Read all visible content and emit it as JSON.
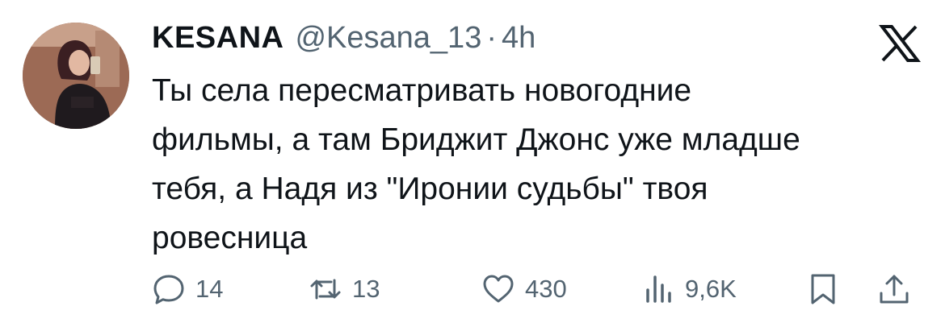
{
  "author": {
    "name": "KESANA",
    "handle": "@Kesana_13",
    "separator": "·",
    "time": "4h"
  },
  "tweet": {
    "text": "Ты села пересматривать новогодние\nфильмы, а там Бриджит Джонс уже младше\nтебя, а Надя из \"Иронии судьбы\" твоя\nровесница"
  },
  "actions": {
    "replies": "14",
    "retweets": "13",
    "likes": "430",
    "views": "9,6K"
  },
  "icons": {
    "reply": "speech-bubble-icon",
    "retweet": "retweet-arrows-icon",
    "like": "heart-icon",
    "views": "bar-chart-icon",
    "bookmark": "bookmark-icon",
    "share": "share-upload-icon",
    "brand": "x-logo-icon"
  },
  "colors": {
    "text": "#0f1419",
    "secondary": "#536471",
    "background": "#ffffff"
  }
}
